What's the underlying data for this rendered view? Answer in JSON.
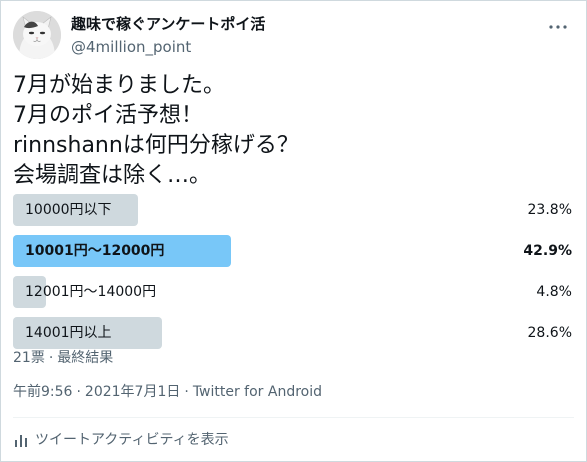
{
  "author": {
    "display_name": "趣味で稼ぐアンケートポイ活",
    "handle": "@4million_point",
    "avatar_icon": "cat-avatar"
  },
  "tweet": {
    "lines": [
      "7月が始まりました。",
      "7月のポイ活予想！",
      "rinnshannは何円分稼げる？",
      "会場調査は除く…。"
    ]
  },
  "poll": {
    "options": [
      {
        "label": "10000円以下",
        "percent_label": "23.8%",
        "percent": 23.8,
        "winner": false
      },
      {
        "label": "10001円〜12000円",
        "percent_label": "42.9%",
        "percent": 42.9,
        "winner": true
      },
      {
        "label": "12001円〜14000円",
        "percent_label": "4.8%",
        "percent": 4.8,
        "winner": false
      },
      {
        "label": "14001円以上",
        "percent_label": "28.6%",
        "percent": 28.6,
        "winner": false
      }
    ],
    "votes": "21票",
    "separator": "·",
    "status": "最終結果"
  },
  "meta": {
    "time": "午前9:56",
    "separator": "·",
    "date": "2021年7月1日",
    "source": "Twitter for Android"
  },
  "activity": {
    "label": "ツイートアクティビティを表示",
    "icon": "bar-chart-icon"
  },
  "colors": {
    "winner_bar": "#78c7f8",
    "bar": "#cfd9de",
    "secondary_text": "#536471"
  }
}
